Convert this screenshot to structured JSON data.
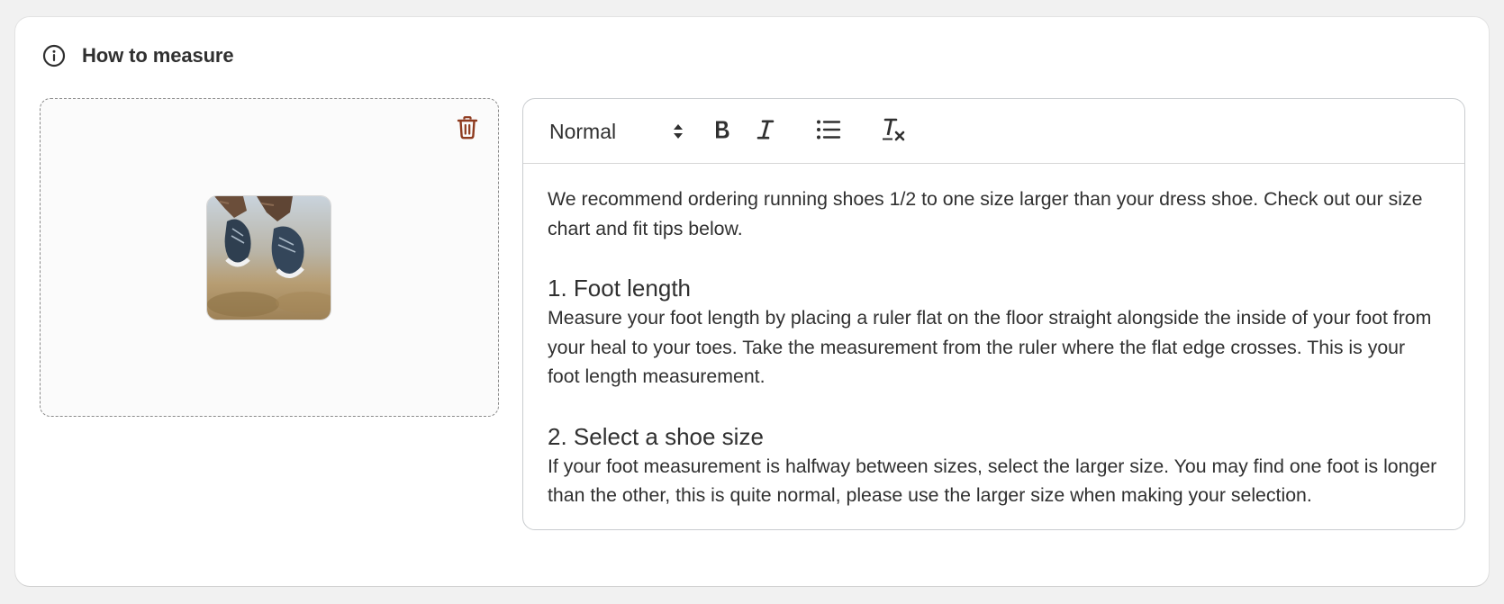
{
  "section": {
    "title": "How to measure",
    "info_icon": "info-circle-icon"
  },
  "image_uploader": {
    "delete_icon": "trash-icon",
    "thumbnail_alt": "Running shoes mid-jump"
  },
  "editor": {
    "toolbar": {
      "format_value": "Normal",
      "buttons": [
        "bold-icon",
        "italic-icon",
        "bullet-list-icon",
        "clear-format-icon"
      ]
    },
    "intro": "We recommend ordering running shoes 1/2 to one size larger than your dress shoe. Check out our size chart and fit tips below.",
    "steps": [
      {
        "heading": "1. Foot length",
        "body": "Measure your foot length by placing a ruler flat on the floor straight alongside the inside of your foot from your heal to your toes. Take the measurement from the ruler where the flat edge crosses. This is your foot length measurement."
      },
      {
        "heading": "2. Select a shoe size",
        "body": "If your foot measurement is halfway between sizes, select the larger size. You may find one foot is longer than the other, this is quite normal, please use the larger size when making your selection."
      }
    ]
  },
  "colors": {
    "delete_icon": "#8e3b1f",
    "text": "#303030"
  }
}
